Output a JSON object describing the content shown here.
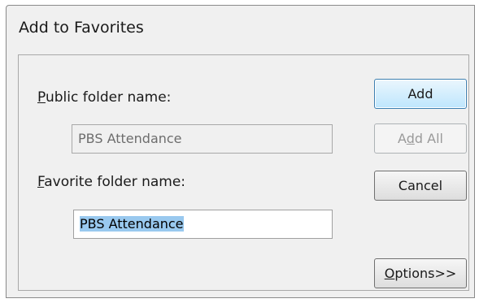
{
  "dialog": {
    "title": "Add to Favorites",
    "public_folder": {
      "label_mnemonic": "P",
      "label_rest": "ublic folder name:",
      "value": "PBS Attendance"
    },
    "favorite_folder": {
      "label_mnemonic": "F",
      "label_rest": "avorite folder name:",
      "value": "PBS Attendance"
    },
    "buttons": {
      "add": "Add",
      "add_all_pre": "A",
      "add_all_mnemonic": "d",
      "add_all_post": "d All",
      "cancel": "Cancel",
      "options_mnemonic": "O",
      "options_rest": "ptions>>"
    }
  }
}
